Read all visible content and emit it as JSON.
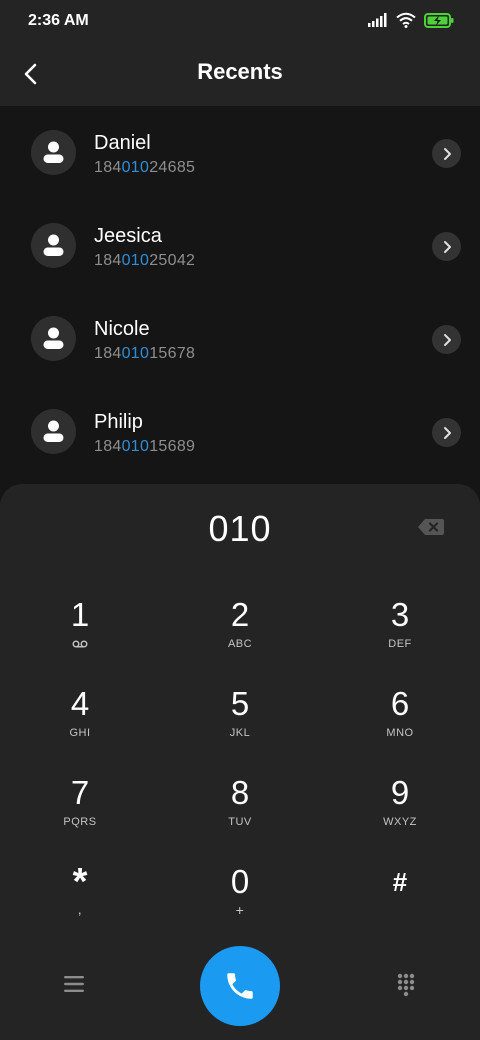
{
  "status_bar": {
    "time": "2:36 AM"
  },
  "header": {
    "title": "Recents"
  },
  "contacts": [
    {
      "name": "Daniel",
      "number_pre": "184",
      "number_match": "010",
      "number_post": "24685"
    },
    {
      "name": "Jeesica",
      "number_pre": "184",
      "number_match": "010",
      "number_post": "25042"
    },
    {
      "name": "Nicole",
      "number_pre": "184",
      "number_match": "010",
      "number_post": "15678"
    },
    {
      "name": "Philip",
      "number_pre": "184",
      "number_match": "010",
      "number_post": "15689"
    }
  ],
  "dialpad": {
    "dialed": "010",
    "keys": [
      {
        "digit": "1",
        "letters": ""
      },
      {
        "digit": "2",
        "letters": "ABC"
      },
      {
        "digit": "3",
        "letters": "DEF"
      },
      {
        "digit": "4",
        "letters": "GHI"
      },
      {
        "digit": "5",
        "letters": "JKL"
      },
      {
        "digit": "6",
        "letters": "MNO"
      },
      {
        "digit": "7",
        "letters": "PQRS"
      },
      {
        "digit": "8",
        "letters": "TUV"
      },
      {
        "digit": "9",
        "letters": "WXYZ"
      },
      {
        "digit": "*",
        "letters": ","
      },
      {
        "digit": "0",
        "letters": "+"
      },
      {
        "digit": "#",
        "letters": ""
      }
    ]
  },
  "icons": {
    "voicemail": "voicemail-icon",
    "back": "arrow-back-icon",
    "chevron": "chevron-right-icon",
    "backspace": "backspace-icon",
    "call": "phone-icon",
    "menu": "menu-icon",
    "keypad": "keypad-icon"
  },
  "colors": {
    "accent": "#1a9bf1",
    "match_highlight": "#2d8fd9",
    "battery": "#4cd137"
  }
}
